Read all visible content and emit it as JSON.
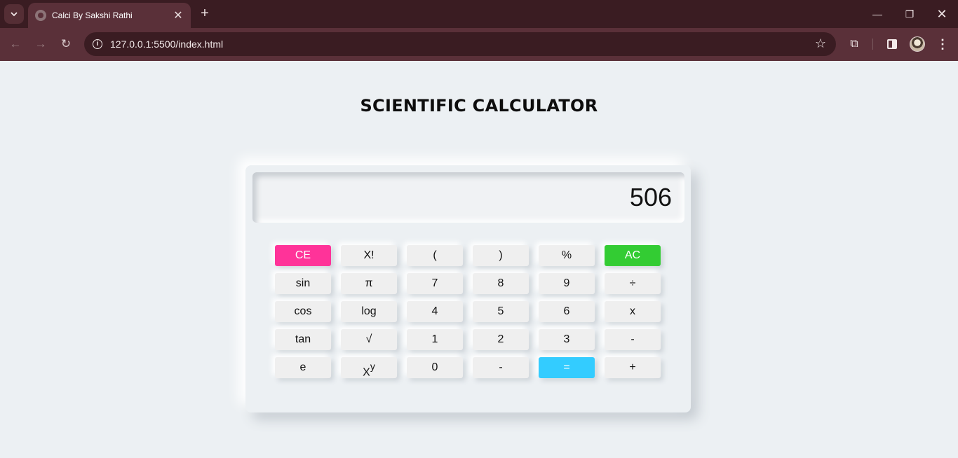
{
  "browser": {
    "tab_title": "Calci By Sakshi Rathi",
    "url": "127.0.0.1:5500/index.html"
  },
  "page": {
    "title": "SCIENTIFIC CALCULATOR",
    "display_value": "506"
  },
  "keys": {
    "ce": "CE",
    "fact": "X!",
    "lparen": "(",
    "rparen": ")",
    "percent": "%",
    "ac": "AC",
    "sin": "sin",
    "pi": "π",
    "k7": "7",
    "k8": "8",
    "k9": "9",
    "divide": "÷",
    "cos": "cos",
    "log": "log",
    "k4": "4",
    "k5": "5",
    "k6": "6",
    "multiply": "x",
    "tan": "tan",
    "sqrt": "√",
    "k1": "1",
    "k2": "2",
    "k3": "3",
    "minus": "-",
    "e": "e",
    "pow_base": "X",
    "pow_exp": "y",
    "k0": "0",
    "dash": "-",
    "equals": "=",
    "plus": "+"
  },
  "colors": {
    "clear_entry": "#ff3399",
    "all_clear": "#33cc33",
    "equals": "#33ccff",
    "page_background": "#ecf0f3",
    "browser_frame": "#3a1c22"
  }
}
